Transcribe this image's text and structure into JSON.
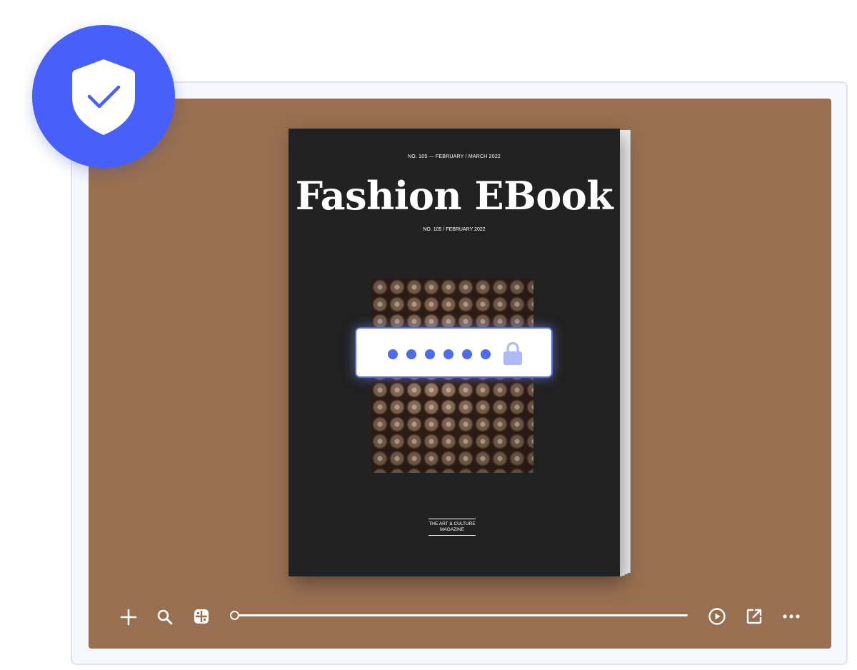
{
  "ebook": {
    "issue_top": "NO. 105 — FEBRUARY / MARCH  2022",
    "title": "Fashion EBook",
    "issue_sub": "NO. 105 / FEBRUARY 2022",
    "tagline_line1": "THE ART & CULTURE",
    "tagline_line2": "MAGAZINE"
  },
  "password": {
    "masked_value": "••••••",
    "dot_count": 6
  },
  "toolbar": {
    "left_icons": [
      "zoom-in-icon",
      "search-icon",
      "grid-view-icon"
    ],
    "right_icons": [
      "play-icon",
      "share-icon",
      "more-icon"
    ],
    "progress": 0
  },
  "colors": {
    "badge": "#4760fb",
    "stage_background": "#986f50",
    "cover_background": "#212121",
    "password_accent": "#5169e6",
    "lock": "#adbaf7"
  },
  "icons": {
    "badge": "shield-check-icon",
    "password": "lock-icon"
  }
}
